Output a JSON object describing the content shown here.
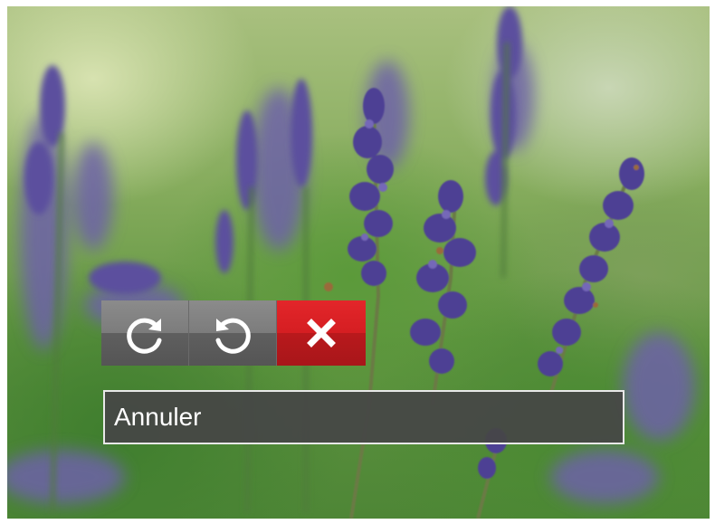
{
  "toolbar": {
    "buttons": [
      {
        "id": "rotate-clockwise",
        "icon": "rotate-clockwise-icon",
        "selected": false
      },
      {
        "id": "rotate-counterclockwise",
        "icon": "rotate-counterclockwise-icon",
        "selected": false
      },
      {
        "id": "cancel",
        "icon": "close-icon",
        "selected": true
      }
    ]
  },
  "caption": {
    "label": "Annuler"
  },
  "colors": {
    "selected_button": "#d51e22",
    "button": "#7c7c7c",
    "caption_background": "#464646",
    "caption_border": "#e8e8e8",
    "caption_text": "#ffffff"
  }
}
